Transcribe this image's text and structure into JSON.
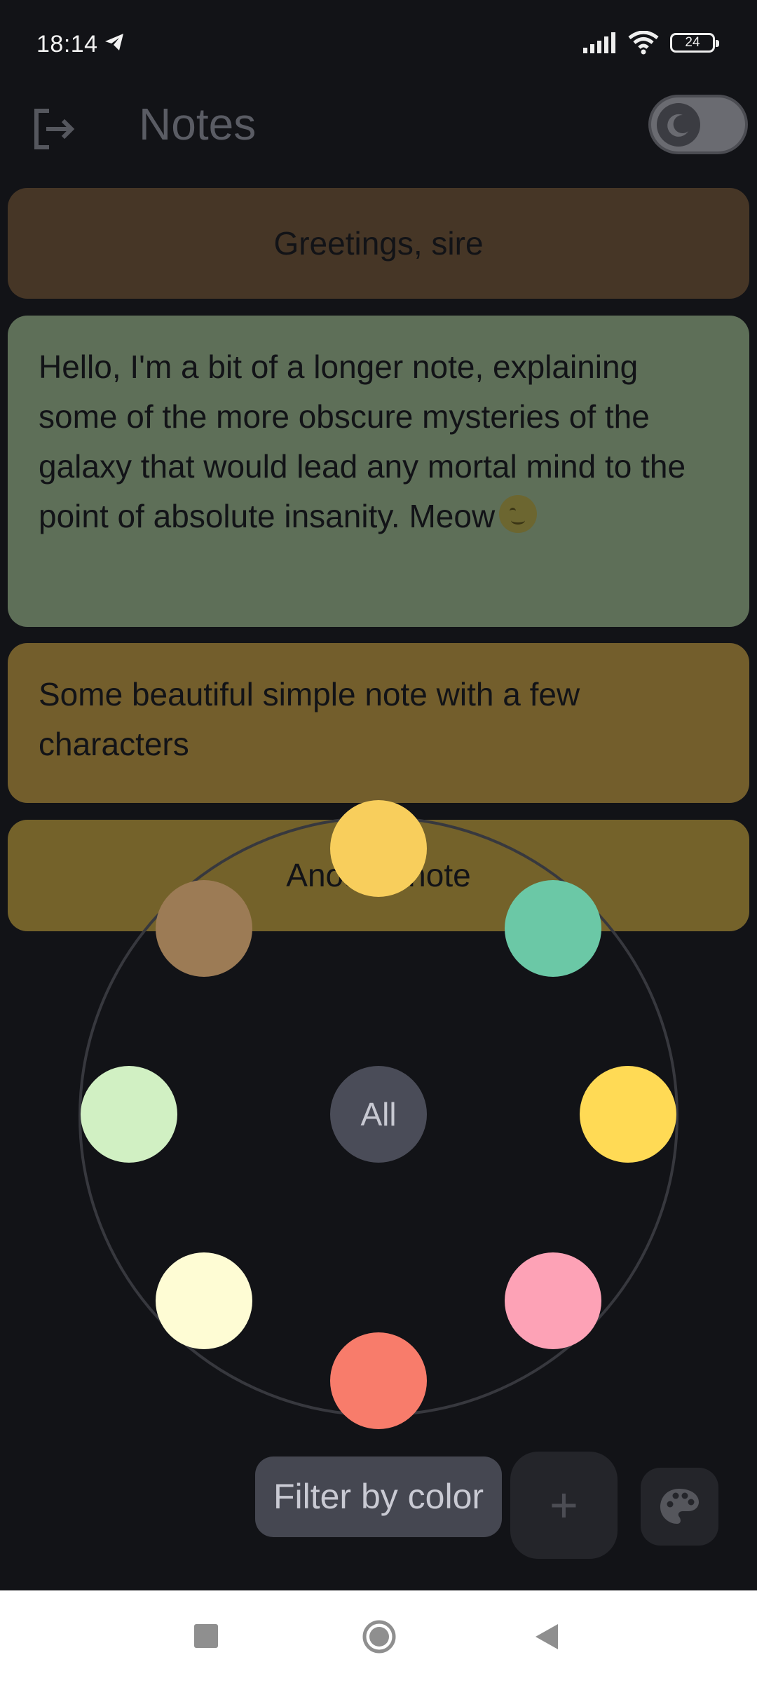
{
  "status_bar": {
    "time": "18:14",
    "battery": "24",
    "icons": [
      "telegram-icon",
      "signal-icon",
      "wifi-icon",
      "battery-icon"
    ]
  },
  "app_bar": {
    "title": "Notes",
    "logout_icon": "logout-icon",
    "theme_toggle": {
      "state": "dark",
      "icon": "moon-icon"
    }
  },
  "notes": [
    {
      "text": "Greetings, sire",
      "color": "#463626"
    },
    {
      "text": "Hello, I'm a bit of a longer note, explaining some of the more obscure mysteries of the galaxy that would lead any mortal mind to the point of absolute insanity. Meow",
      "emoji": "moon-face-emoji",
      "color": "#5e6f58"
    },
    {
      "text": "Some beautiful simple note with a few characters",
      "color": "#735e2c"
    },
    {
      "text": "Another note",
      "color": "#74622a"
    }
  ],
  "color_filter": {
    "all_label": "All",
    "colors": [
      "#f8ce5c",
      "#6bc8a6",
      "#ffda55",
      "#fda2b6",
      "#f87c6b",
      "#fefcd4",
      "#d1f0c3",
      "#9c7b55"
    ]
  },
  "actions": {
    "filter_label": "Filter by color",
    "add_label": "+",
    "palette_icon": "palette-icon"
  },
  "nav_bar": {
    "icons": [
      "recents-icon",
      "home-icon",
      "back-icon"
    ]
  }
}
